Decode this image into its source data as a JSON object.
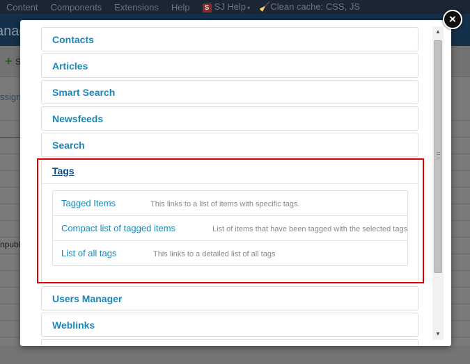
{
  "topbar": {
    "items": [
      "Content",
      "Components",
      "Extensions",
      "Help"
    ],
    "sj_icon_letter": "S",
    "sj_help": "SJ Help",
    "clean_cache": "Clean cache: CSS, JS",
    "caret": "▾"
  },
  "background": {
    "header_title": "anag",
    "toolbar_label": "S",
    "assign_text": "ssign",
    "unpublish_text": "npubl"
  },
  "modal": {
    "close_icon": "×",
    "categories_top": [
      "Contacts",
      "Articles",
      "Smart Search",
      "Newsfeeds",
      "Search"
    ],
    "tags": {
      "label": "Tags",
      "items": [
        {
          "title": "Tagged Items",
          "description": "This links to a list of items with specific tags."
        },
        {
          "title": "Compact list of tagged items",
          "description": "List of items that have been tagged with the selected tags"
        },
        {
          "title": "List of all tags",
          "description": "This links to a detailed list of all tags"
        }
      ]
    },
    "categories_bottom": [
      "Users Manager",
      "Weblinks"
    ]
  },
  "scrollbar": {
    "up_arrow": "▲",
    "down_arrow": "▼"
  },
  "colors": {
    "accent_link": "#1a87b8",
    "active_link": "#0a4a80",
    "highlight_box": "#e00000",
    "topbar_bg": "#1c2533"
  }
}
